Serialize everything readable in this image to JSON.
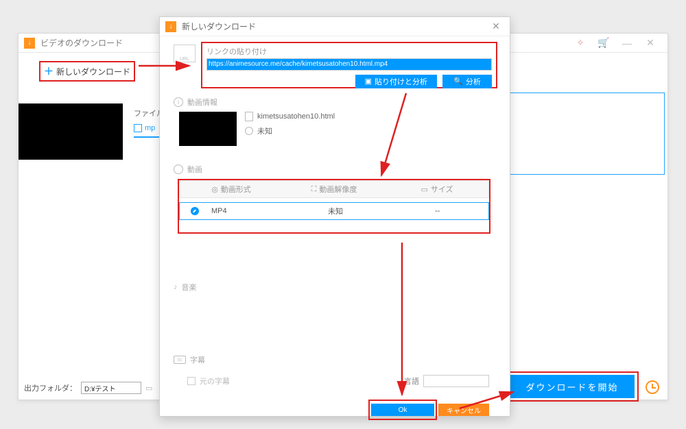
{
  "backwin": {
    "title": "ビデオのダウンロード",
    "new_download": "新しいダウンロード",
    "file_label": "ファイル",
    "mp_label": "mp",
    "output_folder_label": "出力フォルダ：",
    "output_folder_value": "D:¥テスト",
    "start_download": "ダウンロードを開始"
  },
  "dialog": {
    "title": "新しいダウンロード",
    "url_icon_label": "URL",
    "paste_label": "リンクの貼り付け",
    "url_value": "https://animesource.me/cache/kimetsusatohen10.html.mp4",
    "paste_analyze": "貼り付けと分析",
    "analyze": "分析",
    "info_label": "動画情報",
    "filename": "kimetsusatohen10.html",
    "duration": "未知",
    "video_label": "動画",
    "col_format": "動画形式",
    "col_resolution": "動画解像度",
    "col_size": "サイズ",
    "row_format": "MP4",
    "row_resolution": "未知",
    "row_size": "--",
    "music_label": "音楽",
    "subtitle_label": "字幕",
    "original_subtitle": "元の字幕",
    "language_label": "言語",
    "ok": "Ok",
    "cancel": "キャンセル"
  }
}
